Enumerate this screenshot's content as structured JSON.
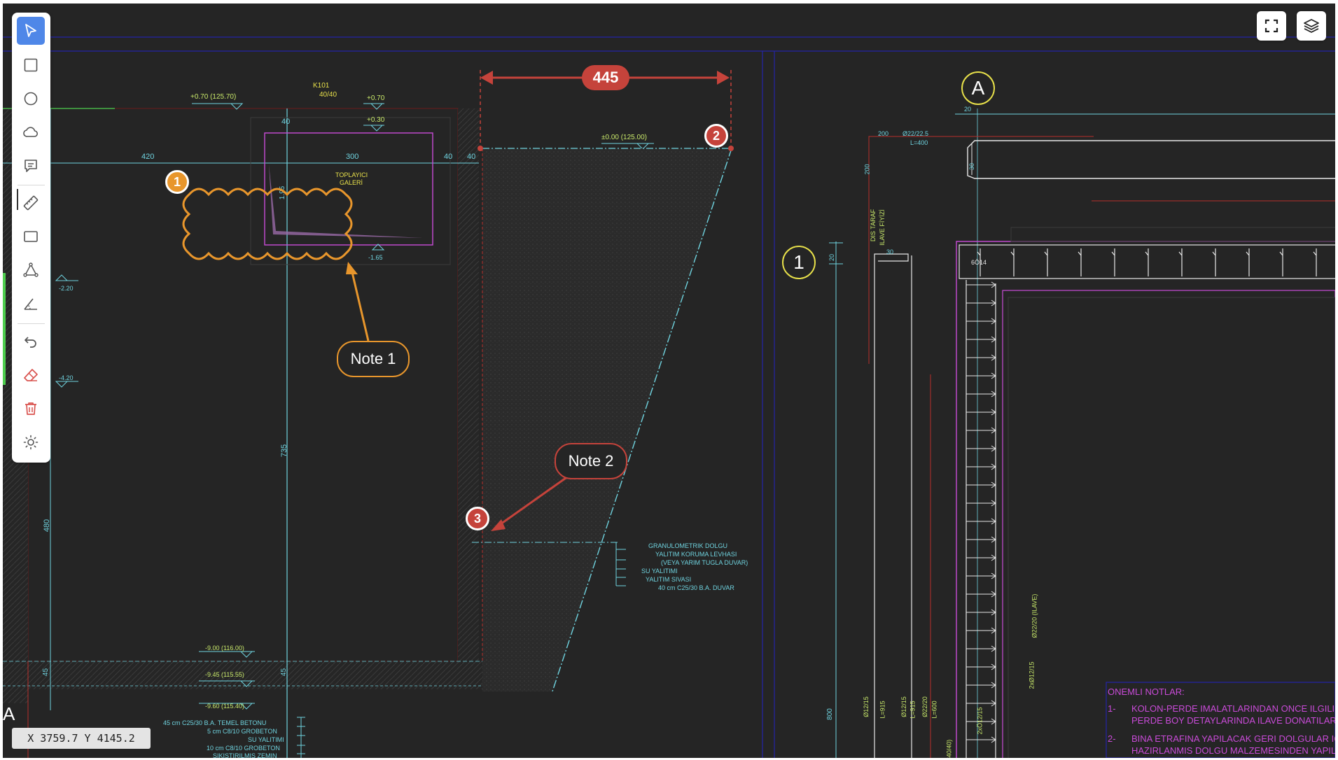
{
  "toolbar": {
    "tools": [
      {
        "name": "select-tool",
        "icon": "cursor-arrow-icon",
        "active": true
      },
      {
        "name": "rectangle-tool",
        "icon": "square-icon"
      },
      {
        "name": "circle-tool",
        "icon": "circle-icon"
      },
      {
        "name": "cloud-tool",
        "icon": "cloud-icon"
      },
      {
        "name": "comment-tool",
        "icon": "comment-icon"
      },
      {
        "name": "measure-distance-tool",
        "icon": "ruler-icon"
      },
      {
        "name": "measure-area-tool",
        "icon": "rectangle-area-icon"
      },
      {
        "name": "polyline-tool",
        "icon": "polyline-icon"
      },
      {
        "name": "angle-tool",
        "icon": "angle-icon"
      },
      {
        "name": "undo-tool",
        "icon": "undo-icon"
      },
      {
        "name": "eraser-tool",
        "icon": "eraser-icon"
      },
      {
        "name": "delete-tool",
        "icon": "trash-icon"
      },
      {
        "name": "brightness-tool",
        "icon": "sun-icon"
      }
    ]
  },
  "view_controls": {
    "fullscreen_icon": "fullscreen-icon",
    "layers_icon": "layers-icon"
  },
  "status": {
    "coordinates": "X 3759.7 Y 4145.2"
  },
  "annotations": {
    "dimension_label": "445",
    "markers": [
      "1",
      "2",
      "3"
    ],
    "notes": [
      "Note 1",
      "Note 2"
    ]
  },
  "colors": {
    "accent": "#4f87e8",
    "orange": "#e8962c",
    "red": "#c5433b",
    "cad_cyan": "#6fd3df",
    "cad_magenta": "#c94bd8",
    "cad_yellow": "#e7e04a",
    "cad_bg": "#252525"
  },
  "drawing": {
    "grid_bubbles": [
      "A",
      "1"
    ],
    "edge_letter": "A",
    "top_labels": [
      "+0.70 (125.70)",
      "K101",
      "40/40",
      "+0.70",
      "+0.30",
      "±0.00 (125.00)"
    ],
    "dims_top": [
      "420",
      "300",
      "40",
      "40",
      "40"
    ],
    "gallery_label": [
      "TOPLAYICI",
      "GALERİ"
    ],
    "vert_dims": [
      "1.95",
      "735",
      "480",
      "45",
      "45",
      "800"
    ],
    "levels_left": [
      "-2.20",
      "-4.20",
      "-1.65"
    ],
    "levels_bottom": [
      "-9.00 (116.00)",
      "-9.45 (115.55)",
      "-9.60 (115.40)"
    ],
    "layer_notes": [
      "GRANULOMETRIK DOLGU",
      "YALITIM KORUMA LEVHASI",
      "(VEYA YARIM TUGLA DUVAR)",
      "SU YALITIMI",
      "YALITIM SIVASI",
      "40 cm C25/30 B.A. DUVAR"
    ],
    "bottom_notes": [
      "45 cm C25/30 B.A. TEMEL BETONU",
      "5 cm C8/10 GROBETON",
      "SU YALITIMI",
      "10 cm C8/10 GROBETON",
      "SIKISTIRILMIS ZEMIN"
    ],
    "rebar_labels": [
      "200",
      "Ø22/22.5",
      "L=400",
      "200",
      "DIS TARAF",
      "ILAVE FİYİZİ",
      "20",
      "30",
      "30",
      "6Ö14",
      "20",
      "Ø22/20 (ILAVE)",
      "2xØ12/15",
      "2xÖ12/15",
      "Ø12/15",
      "Ø12/15",
      "Ø22/20",
      "L=915",
      "L=915",
      "L=600",
      "840/40)"
    ],
    "notes_heading": "ONEMLI NOTLAR:",
    "notes_items": [
      {
        "num": "1-",
        "line1": "KOLON-PERDE IMALATLARINDAN ONCE ILGILI KOLON",
        "line2": "PERDE BOY DETAYLARINDA ILAVE DONATILAR GOSTE"
      },
      {
        "num": "2-",
        "line1": "BINA ETRAFINA YAPILACAK GERI DOLGULAR ICSEL SU",
        "line2": "HAZIRLANMIS DOLGU MALZEMESINDEN YAPILACAKT"
      }
    ]
  }
}
